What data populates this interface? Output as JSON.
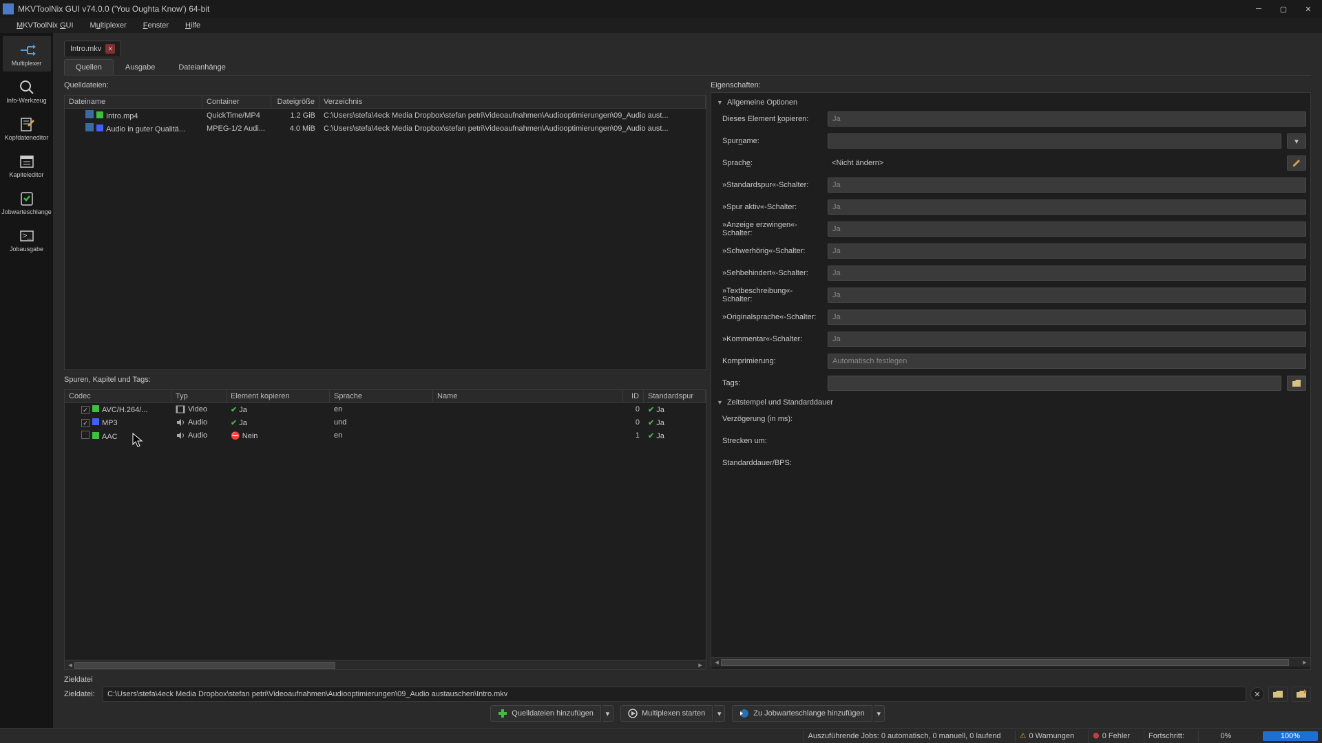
{
  "window": {
    "title": "MKVToolNix GUI v74.0.0 ('You Oughta Know') 64-bit"
  },
  "menubar": [
    "MKVToolNix GUI",
    "Multiplexer",
    "Fenster",
    "Hilfe"
  ],
  "sidebar": [
    {
      "label": "Multiplexer",
      "active": true
    },
    {
      "label": "Info-Werkzeug",
      "active": false
    },
    {
      "label": "Kopfdateneditor",
      "active": false
    },
    {
      "label": "Kapiteleditor",
      "active": false
    },
    {
      "label": "Jobwarteschlange",
      "active": false
    },
    {
      "label": "Jobausgabe",
      "active": false
    }
  ],
  "doc_tab": {
    "label": "Intro.mkv"
  },
  "sub_tabs": [
    {
      "label": "Quellen",
      "active": true
    },
    {
      "label": "Ausgabe",
      "active": false
    },
    {
      "label": "Dateianhänge",
      "active": false
    }
  ],
  "files": {
    "label": "Quelldateien:",
    "headers": {
      "name": "Dateiname",
      "container": "Container",
      "size": "Dateigröße",
      "dir": "Verzeichnis"
    },
    "rows": [
      {
        "name": "Intro.mp4",
        "container": "QuickTime/MP4",
        "size": "1.2 GiB",
        "dir": "C:\\Users\\stefa\\4eck Media Dropbox\\stefan petri\\Videoaufnahmen\\Audiooptimierungen\\09_Audio aust...",
        "color": "#3fbf3f"
      },
      {
        "name": "Audio in guter Qualitä...",
        "container": "MPEG-1/2 Audi...",
        "size": "4.0 MiB",
        "dir": "C:\\Users\\stefa\\4eck Media Dropbox\\stefan petri\\Videoaufnahmen\\Audiooptimierungen\\09_Audio aust...",
        "color": "#3f5fff"
      }
    ]
  },
  "tracks": {
    "label": "Spuren, Kapitel und Tags:",
    "headers": {
      "codec": "Codec",
      "type": "Typ",
      "copy": "Element kopieren",
      "lang": "Sprache",
      "name": "Name",
      "id": "ID",
      "default": "Standardspur"
    },
    "rows": [
      {
        "checked": true,
        "color": "#3fbf3f",
        "codec": "AVC/H.264/...",
        "type": "Video",
        "copy_icon": "yes",
        "copy": "Ja",
        "lang": "en",
        "name": "",
        "id": "0",
        "default_icon": "yes",
        "default": "Ja"
      },
      {
        "checked": true,
        "color": "#3f5fff",
        "codec": "MP3",
        "type": "Audio",
        "copy_icon": "yes",
        "copy": "Ja",
        "lang": "und",
        "name": "",
        "id": "0",
        "default_icon": "yes",
        "default": "Ja"
      },
      {
        "checked": false,
        "color": "#3fbf3f",
        "codec": "AAC",
        "type": "Audio",
        "copy_icon": "no",
        "copy": "Nein",
        "lang": "en",
        "name": "",
        "id": "1",
        "default_icon": "yes",
        "default": "Ja"
      }
    ]
  },
  "props": {
    "label": "Eigenschaften:",
    "group_general": "Allgemeine Optionen",
    "fields": {
      "copy": {
        "label": "Dieses Element kopieren:",
        "value": "Ja"
      },
      "trackname": {
        "label": "Spurname:",
        "value": ""
      },
      "language": {
        "label": "Sprache:",
        "value": "<Nicht ändern>"
      },
      "default_flag": {
        "label": "»Standardspur«-Schalter:",
        "value": "Ja"
      },
      "active_flag": {
        "label": "»Spur aktiv«-Schalter:",
        "value": "Ja"
      },
      "forced_flag": {
        "label": "»Anzeige erzwingen«-Schalter:",
        "value": "Ja"
      },
      "hearing_flag": {
        "label": "»Schwerhörig«-Schalter:",
        "value": "Ja"
      },
      "visual_flag": {
        "label": "»Sehbehindert«-Schalter:",
        "value": "Ja"
      },
      "textdesc_flag": {
        "label": "»Textbeschreibung«-Schalter:",
        "value": "Ja"
      },
      "origlang_flag": {
        "label": "»Originalsprache«-Schalter:",
        "value": "Ja"
      },
      "comment_flag": {
        "label": "»Kommentar«-Schalter:",
        "value": "Ja"
      },
      "compression": {
        "label": "Komprimierung:",
        "value": "Automatisch festlegen"
      },
      "tags": {
        "label": "Tags:",
        "value": ""
      }
    },
    "group_timing": "Zeitstempel und Standarddauer",
    "timing": {
      "delay": {
        "label": "Verzögerung (in ms):",
        "value": ""
      },
      "stretch": {
        "label": "Strecken um:",
        "value": ""
      },
      "bps": {
        "label": "Standarddauer/BPS:",
        "value": ""
      }
    }
  },
  "dest": {
    "section_label": "Zieldatei",
    "field_label": "Zieldatei:",
    "value": "C:\\Users\\stefa\\4eck Media Dropbox\\stefan petri\\Videoaufnahmen\\Audiooptimierungen\\09_Audio austauschen\\Intro.mkv"
  },
  "actions": {
    "add_source": "Quelldateien hinzufügen",
    "start_mux": "Multiplexen starten",
    "add_queue": "Zu Jobwarteschlange hinzufügen"
  },
  "status": {
    "jobs": "Auszuführende Jobs:  0 automatisch, 0 manuell, 0 laufend",
    "warnings": "0 Warnungen",
    "errors": "0 Fehler",
    "progress_label": "Fortschritt:",
    "progress_pct": "0%",
    "progress_bar": "100%"
  }
}
